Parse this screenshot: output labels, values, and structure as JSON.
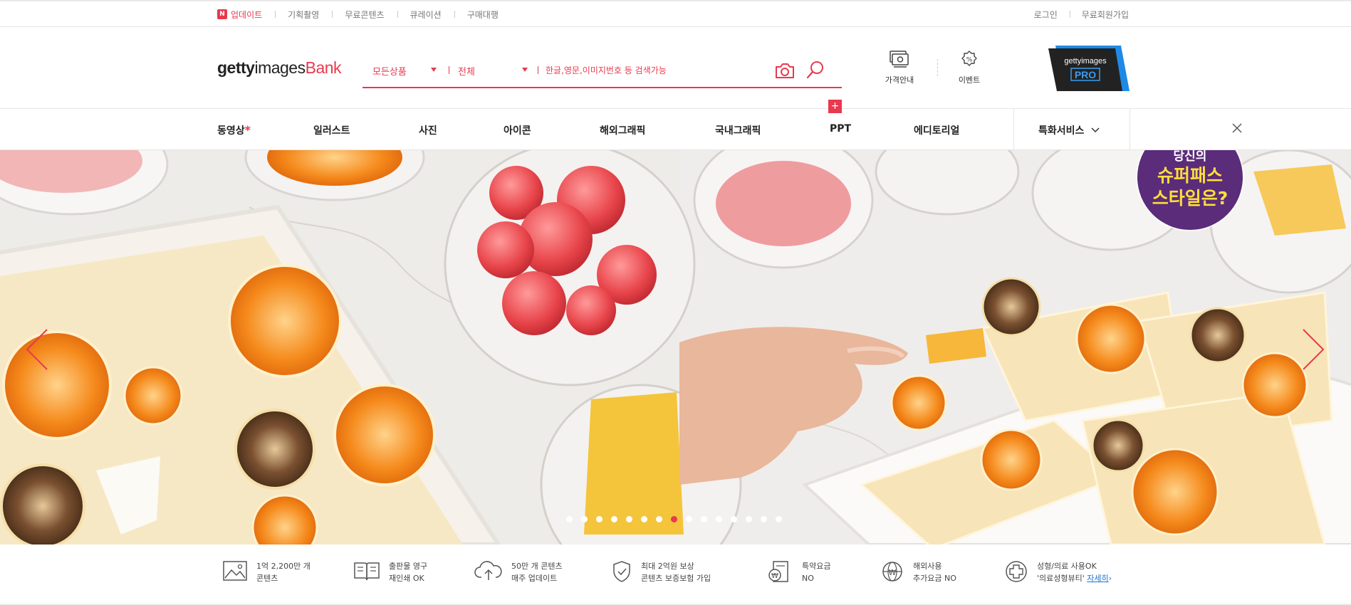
{
  "topbar": {
    "left": [
      {
        "label": "업데이트",
        "badge": "N"
      },
      {
        "label": "기획촬영"
      },
      {
        "label": "무료콘텐츠"
      },
      {
        "label": "큐레이션"
      },
      {
        "label": "구매대행"
      }
    ],
    "right": [
      {
        "label": "로그인"
      },
      {
        "label": "무료회원가입"
      }
    ]
  },
  "logo": {
    "part1": "getty",
    "part2": "images",
    "part3": "Bank"
  },
  "search": {
    "category": "모든상품",
    "scope": "전체",
    "placeholder": "한글,영문,이미지번호 등 검색가능",
    "plus": "+"
  },
  "header_links": [
    {
      "label": "가격안내",
      "icon": "price-icon"
    },
    {
      "label": "이벤트",
      "icon": "event-icon"
    }
  ],
  "pro_badge": {
    "top": "gettyimages",
    "bottom": "PRO"
  },
  "nav": {
    "items": [
      "동영상",
      "일러스트",
      "사진",
      "아이콘",
      "해외그래픽",
      "국내그래픽",
      "PPT",
      "에디토리얼"
    ],
    "star": "*",
    "special": "특화서비스"
  },
  "hero": {
    "slides_total": 15,
    "active_slide": 8,
    "bubble": {
      "line1": "당신의",
      "line2": "슈퍼패스",
      "line3": "스타일은?"
    }
  },
  "features": [
    {
      "icon": "image-icon",
      "line1": "1억 2,200만 개",
      "line2": "콘텐츠"
    },
    {
      "icon": "book-icon",
      "line1": "출판물 영구",
      "line2": "재인쇄 OK"
    },
    {
      "icon": "cloud-upload-icon",
      "line1": "50만 개 콘텐츠",
      "line2": "매주 업데이트"
    },
    {
      "icon": "shield-icon",
      "line1": "최대 2억원 보상",
      "line2": "콘텐츠 보증보험 가입"
    },
    {
      "icon": "won-doc-icon",
      "line1": "특약요금",
      "line2": "NO"
    },
    {
      "icon": "globe-won-icon",
      "line1": "해외사용",
      "line2": "추가요금 NO"
    },
    {
      "icon": "medical-cross-icon",
      "line1": "성형/의료 사용OK",
      "line2": "'의료성형뷰티'",
      "more": "자세히"
    }
  ],
  "colors": {
    "accent": "#e8394e",
    "link": "#1b73d3"
  }
}
